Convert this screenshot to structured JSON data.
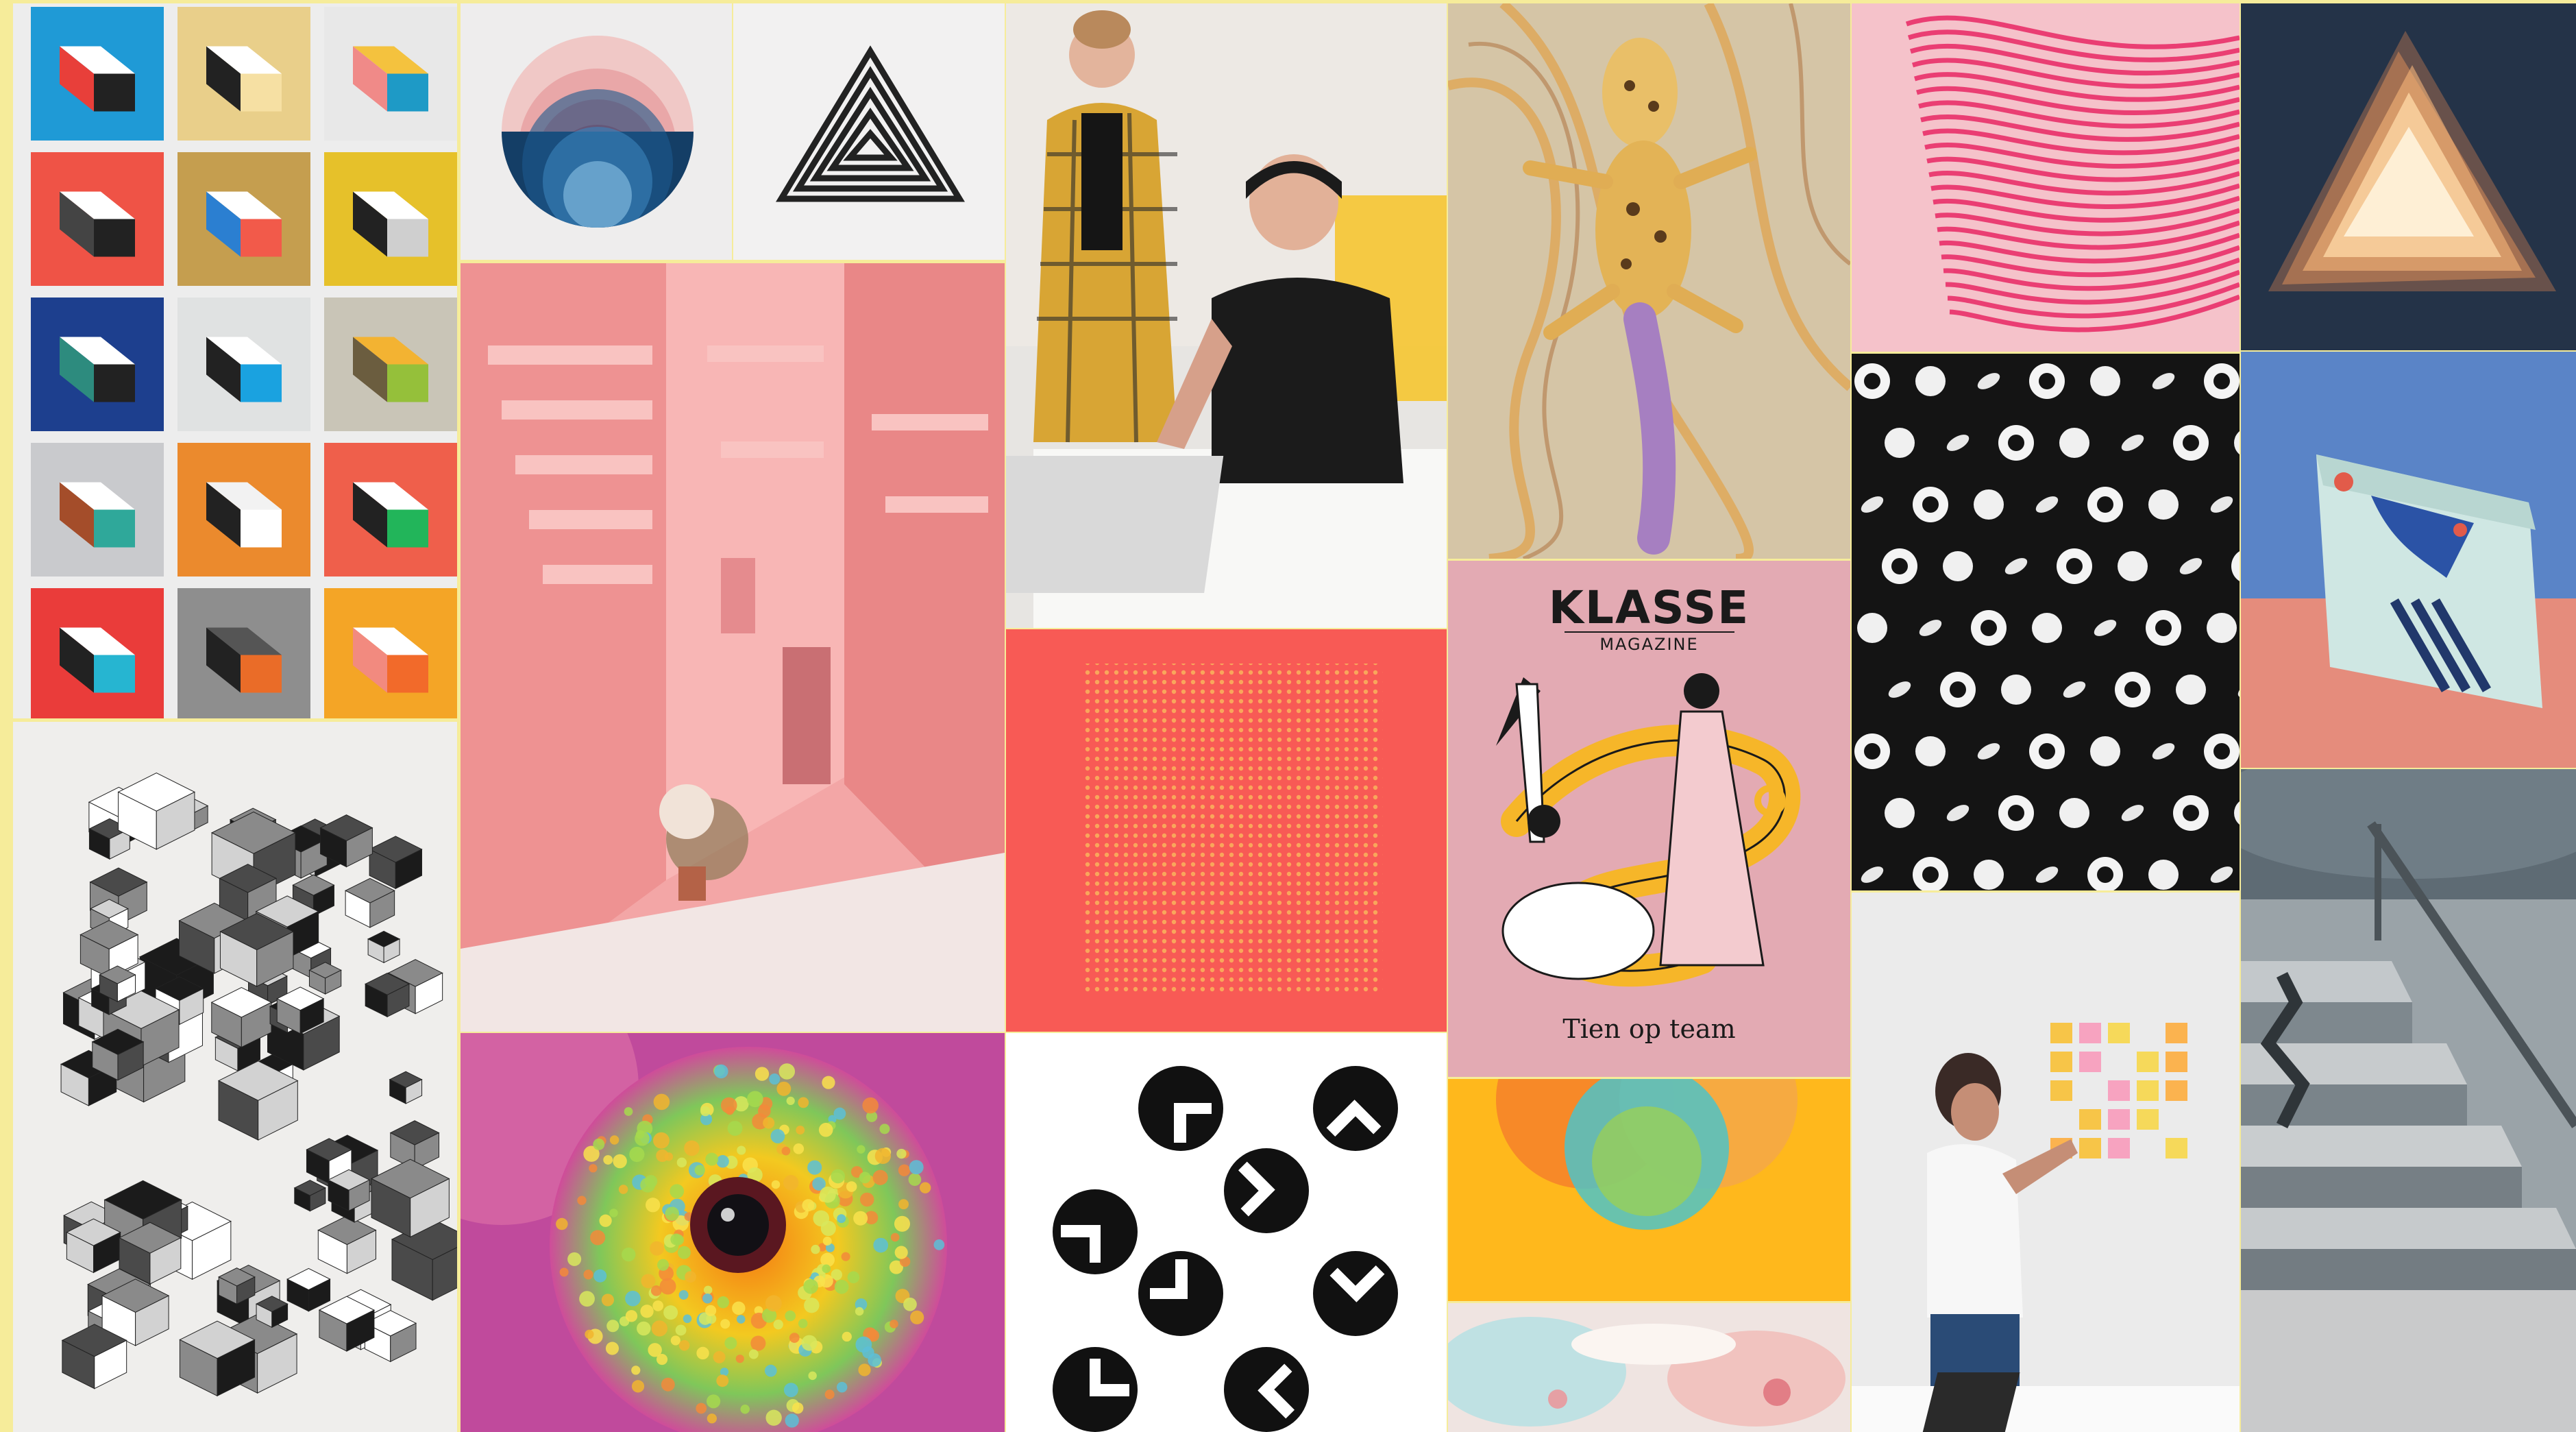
{
  "magazine": {
    "title": "KLASSE",
    "subtitle": "MAGAZINE",
    "bottom_text": "Tien op team"
  },
  "colors": {
    "background": "#f6ec9a",
    "coral": "#f85a55",
    "pink": "#f2a7a9",
    "yellow": "#ffba1a",
    "magazine_pink": "#e3aab3"
  }
}
